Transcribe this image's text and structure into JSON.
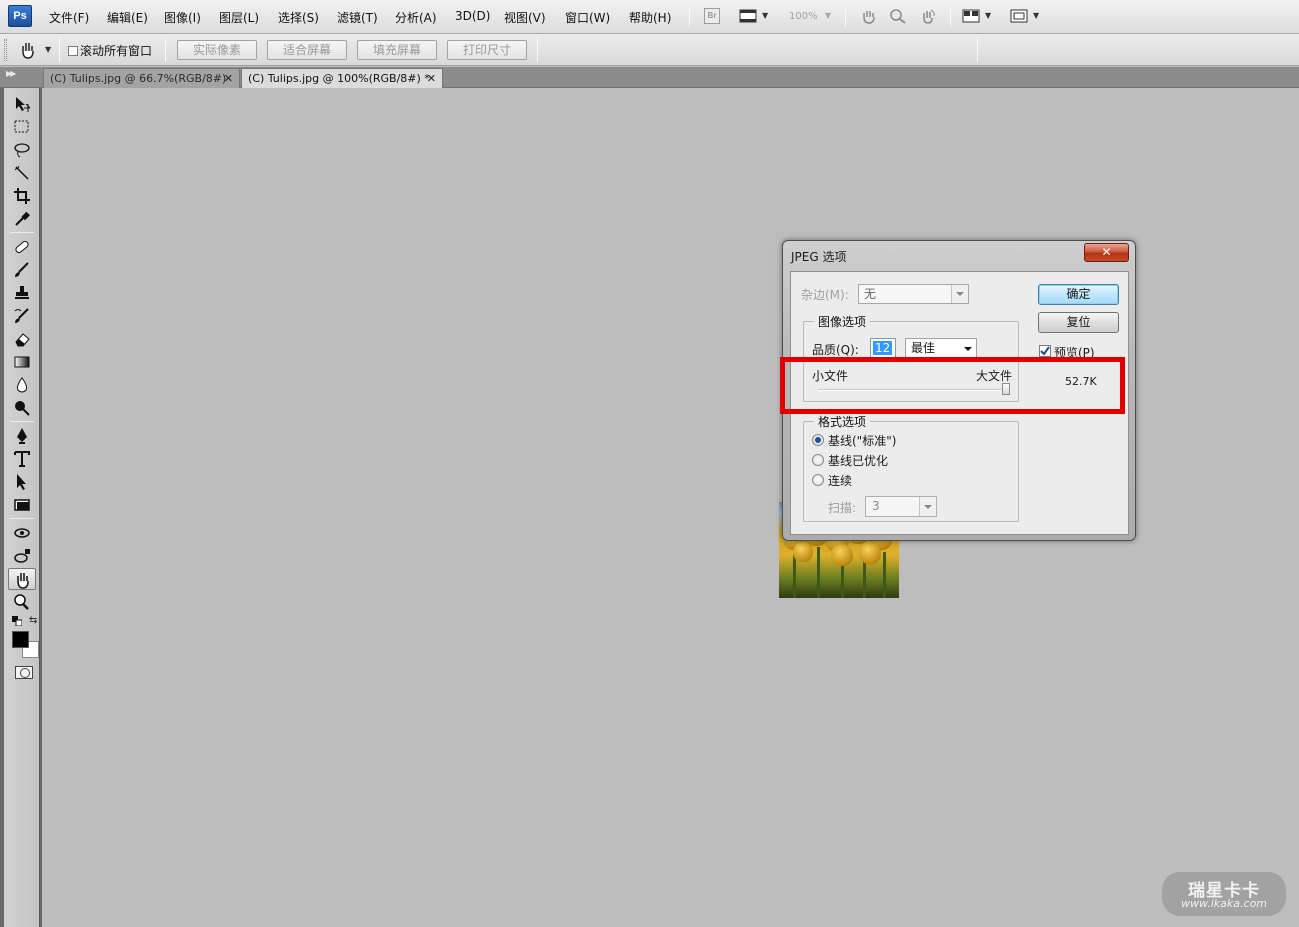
{
  "app": {
    "logo_text": "Ps"
  },
  "menubar": {
    "items": [
      "文件(F)",
      "编辑(E)",
      "图像(I)",
      "图层(L)",
      "选择(S)",
      "滤镜(T)",
      "分析(A)",
      "3D(D)",
      "视图(V)",
      "窗口(W)",
      "帮助(H)"
    ],
    "bridge_label": "Br",
    "zoom_level": "100%"
  },
  "options_bar": {
    "scroll_all_windows_label": "滚动所有窗口",
    "scroll_all_windows_checked": false,
    "buttons": [
      "实际像素",
      "适合屏幕",
      "填充屏幕",
      "打印尺寸"
    ]
  },
  "tabs": [
    {
      "label": "(C) Tulips.jpg @ 66.7%(RGB/8#)",
      "active": false
    },
    {
      "label": "(C) Tulips.jpg @ 100%(RGB/8#) *",
      "active": true
    }
  ],
  "tools": [
    "move-tool",
    "marquee-tool",
    "lasso-tool",
    "quick-selection-tool",
    "crop-tool",
    "eyedropper-tool",
    "healing-brush-tool",
    "brush-tool",
    "clone-stamp-tool",
    "history-brush-tool",
    "eraser-tool",
    "gradient-tool",
    "blur-tool",
    "dodge-tool",
    "pen-tool",
    "type-tool",
    "path-selection-tool",
    "shape-tool",
    "3d-rotate-tool",
    "3d-orbit-tool",
    "hand-tool",
    "zoom-tool"
  ],
  "active_tool": "hand-tool",
  "colors": {
    "foreground": "#000000",
    "background": "#ffffff",
    "highlight": "#e00000"
  },
  "dialog": {
    "title": "JPEG 选项",
    "close_symbol": "✕",
    "matte": {
      "label": "杂边(M):",
      "value": "无"
    },
    "image_options": {
      "title": "图像选项",
      "quality_label": "品质(Q):",
      "quality_value": "12",
      "quality_preset": "最佳",
      "small_file_label": "小文件",
      "large_file_label": "大文件",
      "quality_level": 12,
      "quality_max": 12
    },
    "format_options": {
      "title": "格式选项",
      "options": [
        {
          "label": "基线(\"标准\")",
          "selected": true
        },
        {
          "label": "基线已优化",
          "selected": false
        },
        {
          "label": "连续",
          "selected": false
        }
      ],
      "scan_label": "扫描:",
      "scan_value": "3"
    },
    "ok_label": "确定",
    "reset_label": "复位",
    "preview_label": "预览(P)",
    "preview_checked": true,
    "file_size": "52.7K"
  },
  "watermark": {
    "brand": "瑞星卡卡",
    "url": "www.ikaka.com"
  }
}
